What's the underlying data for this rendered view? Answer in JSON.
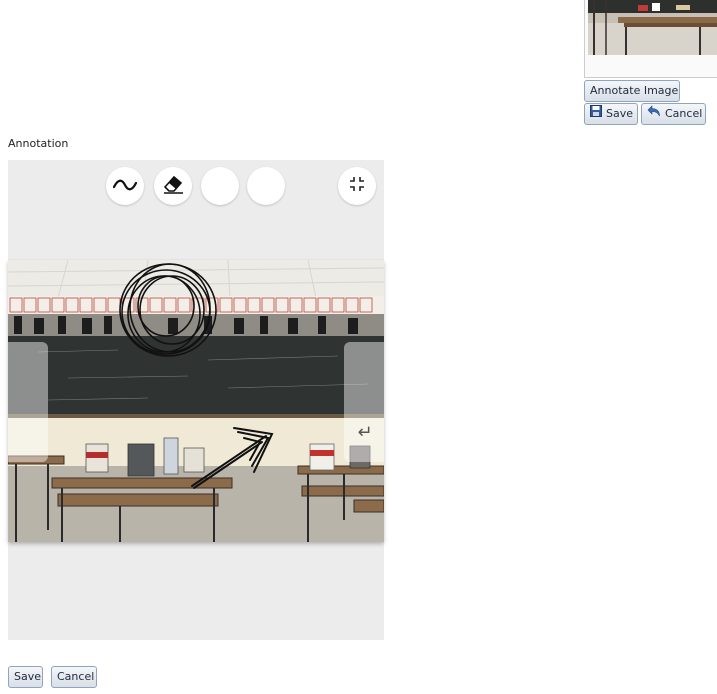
{
  "thumbnail_panel": {
    "annotate_label": "Annotate Image",
    "save_label": "Save",
    "cancel_label": "Cancel"
  },
  "annotation": {
    "label": "Annotation",
    "tools": [
      "freehand-draw-icon",
      "eraser-icon",
      "blank-tool",
      "blank-tool",
      "exit-fullscreen-icon"
    ],
    "enter_icon": "↵"
  },
  "footer": {
    "save_label": "Save",
    "cancel_label": "Cancel"
  }
}
